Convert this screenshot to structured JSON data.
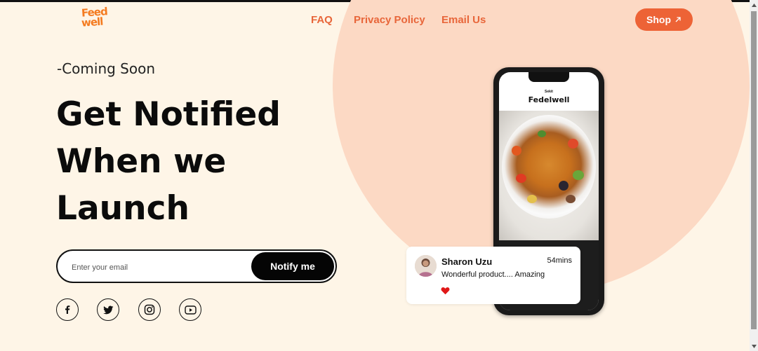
{
  "brand": {
    "logo_line1": "Feed",
    "logo_line2": "well",
    "accent": "#ed6336"
  },
  "nav": {
    "faq": "FAQ",
    "privacy": "Privacy Policy",
    "email": "Email Us"
  },
  "shop": {
    "label": "Shop",
    "icon": "arrow-up-right-icon"
  },
  "hero": {
    "eyebrow": "-Coming Soon",
    "headline": "Get Notified When we Launch"
  },
  "signup": {
    "placeholder": "Enter your email",
    "button": "Notify me"
  },
  "social": [
    "facebook-icon",
    "twitter-icon",
    "instagram-icon",
    "youtube-icon"
  ],
  "phone": {
    "app_small": "Sekit",
    "app_title": "Fedelwell"
  },
  "review": {
    "name": "Sharon Uzu",
    "time": "54mins",
    "message": "Wonderful product.... Amazing"
  },
  "colors": {
    "background": "#fef5e7",
    "circle": "#fcd9c4",
    "nav_text": "#e8663a"
  }
}
